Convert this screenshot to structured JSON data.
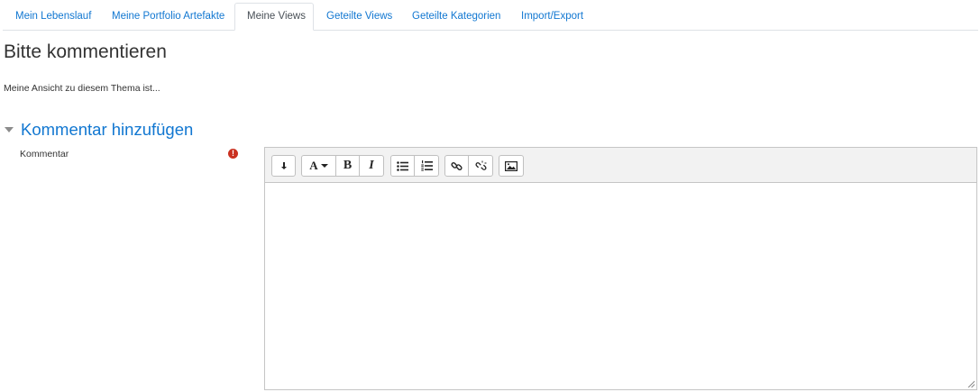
{
  "tabs": [
    {
      "label": "Mein Lebenslauf",
      "active": false
    },
    {
      "label": "Meine Portfolio Artefakte",
      "active": false
    },
    {
      "label": "Meine Views",
      "active": true
    },
    {
      "label": "Geteilte Views",
      "active": false
    },
    {
      "label": "Geteilte Kategorien",
      "active": false
    },
    {
      "label": "Import/Export",
      "active": false
    }
  ],
  "page": {
    "title": "Bitte kommentieren",
    "intro": "Meine Ansicht zu diesem Thema ist..."
  },
  "section": {
    "title": "Kommentar hinzufügen",
    "field_label": "Kommentar",
    "required_symbol": "!"
  },
  "editor": {
    "value": "",
    "toolbar": [
      "expand-toolbar-icon",
      "font-style-menu",
      "bold",
      "italic",
      "unordered-list-icon",
      "ordered-list-icon",
      "link-icon",
      "unlink-icon",
      "image-icon"
    ],
    "font_button_label": "A",
    "bold_label": "B",
    "italic_label": "I"
  },
  "colors": {
    "link": "#1177d1",
    "required": "#ca3120",
    "toolbar_bg": "#f2f2f2"
  }
}
